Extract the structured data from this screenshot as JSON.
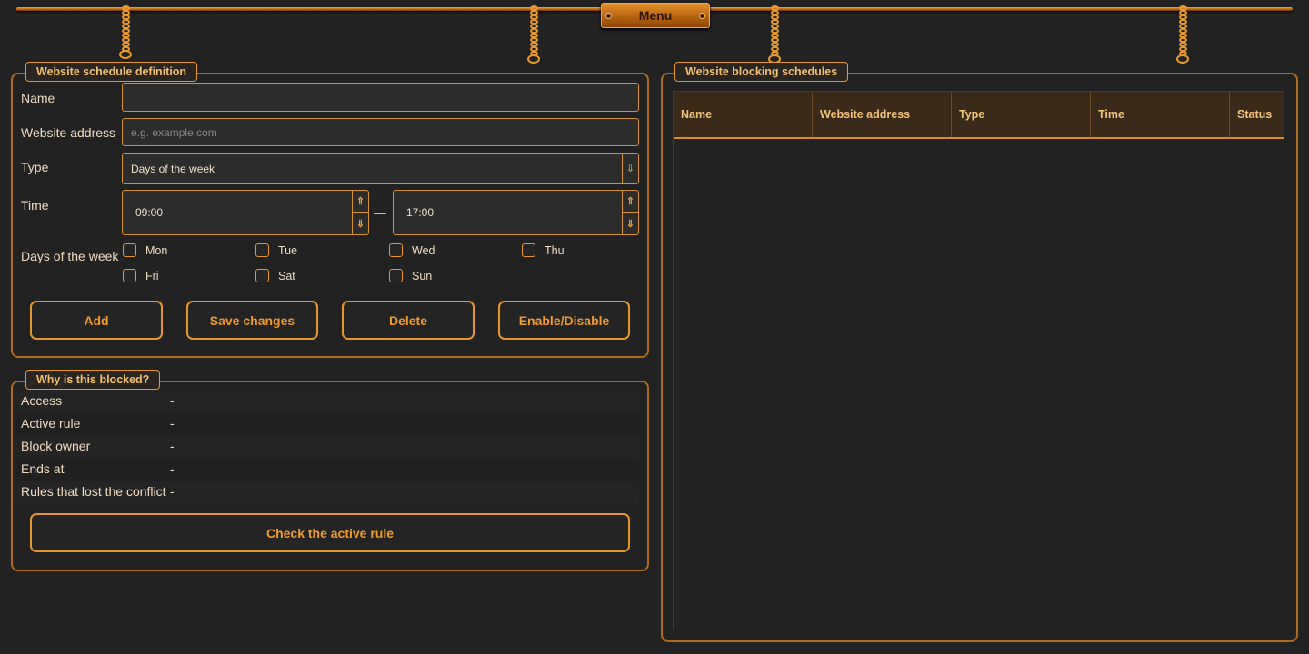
{
  "menu": {
    "label": "Menu"
  },
  "schedule_form": {
    "title": "Website schedule definition",
    "name": {
      "label": "Name",
      "value": ""
    },
    "website": {
      "label": "Website address",
      "placeholder": "e.g. example.com",
      "value": ""
    },
    "type": {
      "label": "Type",
      "value": "Days of the week",
      "arrow_icon": "chevron-down-icon"
    },
    "time": {
      "label": "Time",
      "start": "09:00",
      "end": "17:00",
      "separator": "—"
    },
    "days": {
      "label": "Days of the week",
      "items": [
        {
          "label": "Mon",
          "checked": false
        },
        {
          "label": "Tue",
          "checked": false
        },
        {
          "label": "Wed",
          "checked": false
        },
        {
          "label": "Thu",
          "checked": false
        },
        {
          "label": "Fri",
          "checked": false
        },
        {
          "label": "Sat",
          "checked": false
        },
        {
          "label": "Sun",
          "checked": false
        }
      ]
    },
    "buttons": {
      "add": "Add",
      "save": "Save changes",
      "delete": "Delete",
      "toggle": "Enable/Disable"
    }
  },
  "blocked_info": {
    "title": "Why is this blocked?",
    "rows": [
      {
        "key": "Access",
        "value": "-"
      },
      {
        "key": "Active rule",
        "value": "-"
      },
      {
        "key": "Block owner",
        "value": "-"
      },
      {
        "key": "Ends at",
        "value": "-"
      },
      {
        "key": "Rules that lost the conflict",
        "value": "-"
      }
    ],
    "check_button": "Check the active rule"
  },
  "schedules_table": {
    "title": "Website blocking schedules",
    "columns": [
      "Name",
      "Website address",
      "Type",
      "Time",
      "Status"
    ],
    "rows": []
  },
  "colors": {
    "accent": "#e8962c",
    "background": "#222222",
    "text": "#efdcc2",
    "header_bg": "#3a2a1a"
  }
}
